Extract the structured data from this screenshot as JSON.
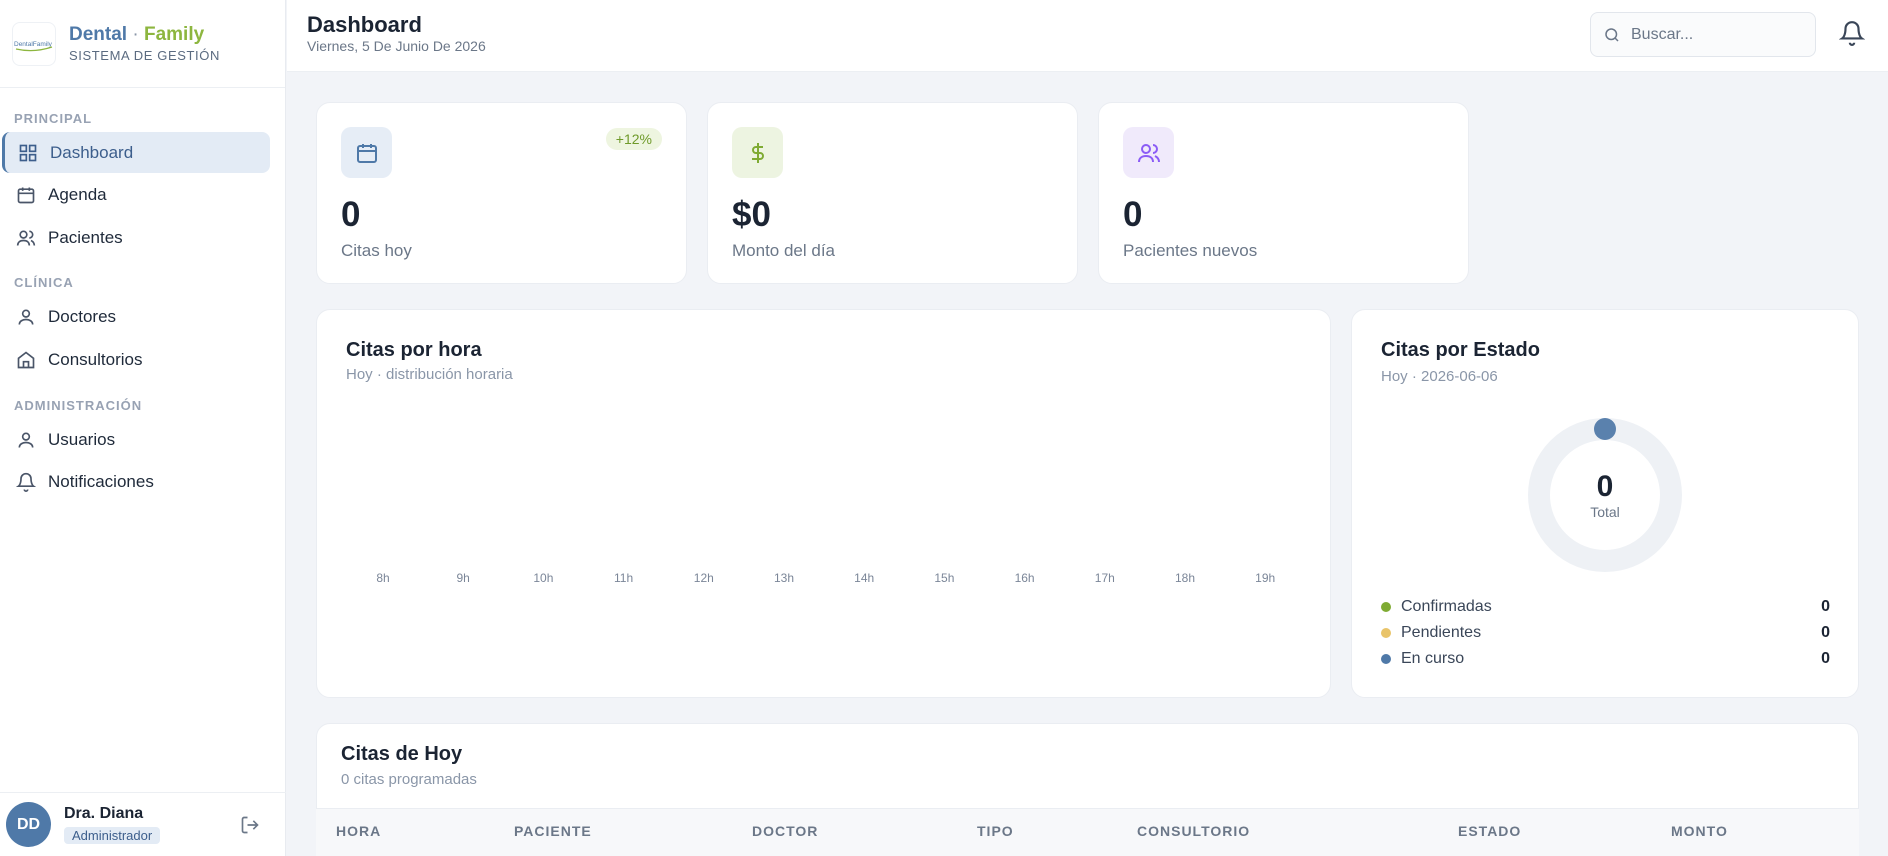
{
  "brand": {
    "logo_text": "DentalFamily",
    "name_dental": "Dental",
    "name_sep": " · ",
    "name_family": "Family",
    "subtitle": "SISTEMA DE GESTIÓN"
  },
  "sidebar": {
    "sections": [
      {
        "label": "PRINCIPAL",
        "items": [
          {
            "label": "Dashboard",
            "icon": "grid-icon",
            "active": true
          },
          {
            "label": "Agenda",
            "icon": "calendar-icon"
          },
          {
            "label": "Pacientes",
            "icon": "users-icon"
          }
        ]
      },
      {
        "label": "CLÍNICA",
        "items": [
          {
            "label": "Doctores",
            "icon": "user-icon"
          },
          {
            "label": "Consultorios",
            "icon": "home-icon"
          }
        ]
      },
      {
        "label": "ADMINISTRACIÓN",
        "items": [
          {
            "label": "Usuarios",
            "icon": "user-icon"
          },
          {
            "label": "Notificaciones",
            "icon": "bell-icon"
          }
        ]
      }
    ],
    "user": {
      "initials": "DD",
      "name": "Dra. Diana",
      "role": "Administrador"
    }
  },
  "header": {
    "title": "Dashboard",
    "date": "Viernes, 5 De Junio De 2026",
    "search_placeholder": "Buscar..."
  },
  "stats": [
    {
      "value": "0",
      "label": "Citas hoy",
      "badge": "+12%",
      "icon": "calendar-icon",
      "color": "#4f79a8",
      "bg": "#e6edf6"
    },
    {
      "value": "$0",
      "label": "Monto del día",
      "icon": "dollar-icon",
      "color": "#7fab33",
      "bg": "#edf4e1"
    },
    {
      "value": "0",
      "label": "Pacientes nuevos",
      "icon": "users-icon",
      "color": "#8b5cf6",
      "bg": "#f0eafb"
    }
  ],
  "hourly": {
    "title": "Citas por hora",
    "subtitle": "Hoy · distribución horaria",
    "chart_data": {
      "type": "bar",
      "categories": [
        "8h",
        "9h",
        "10h",
        "11h",
        "12h",
        "13h",
        "14h",
        "15h",
        "16h",
        "17h",
        "18h",
        "19h"
      ],
      "values": [
        0,
        0,
        0,
        0,
        0,
        0,
        0,
        0,
        0,
        0,
        0,
        0
      ],
      "title": "Citas por hora",
      "xlabel": "",
      "ylabel": ""
    }
  },
  "status": {
    "title": "Citas por Estado",
    "subtitle": "Hoy · 2026-06-06",
    "total": "0",
    "total_label": "Total",
    "chart_data": {
      "type": "pie",
      "categories": [
        "Confirmadas",
        "Pendientes",
        "En curso"
      ],
      "values": [
        0,
        0,
        0
      ],
      "colors": [
        "#7fab33",
        "#e9c46a",
        "#4f79a8"
      ]
    },
    "legend": [
      {
        "label": "Confirmadas",
        "value": "0",
        "color": "#7fab33"
      },
      {
        "label": "Pendientes",
        "value": "0",
        "color": "#e9c46a"
      },
      {
        "label": "En curso",
        "value": "0",
        "color": "#4f79a8"
      }
    ]
  },
  "today": {
    "title": "Citas de Hoy",
    "subtitle": "0 citas programadas",
    "columns": [
      "HORA",
      "PACIENTE",
      "DOCTOR",
      "TIPO",
      "CONSULTORIO",
      "ESTADO",
      "MONTO"
    ]
  }
}
